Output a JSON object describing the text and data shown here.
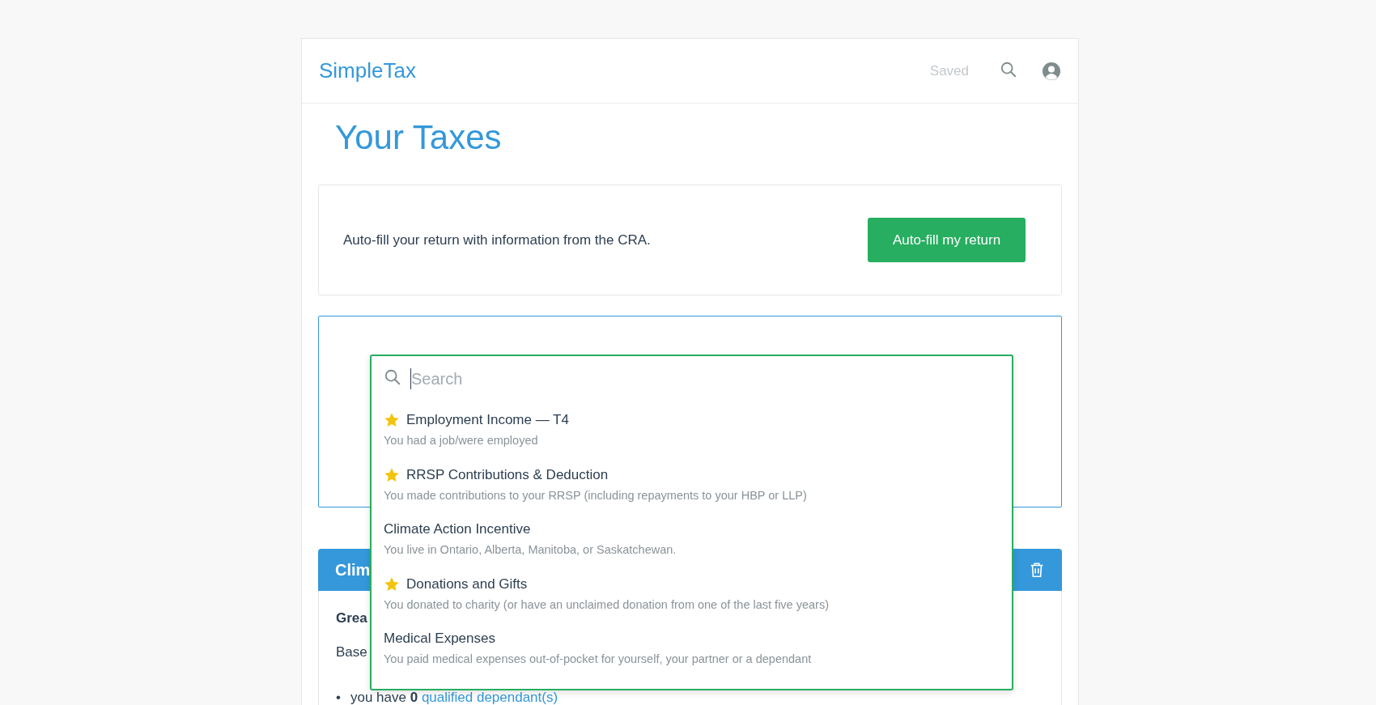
{
  "header": {
    "logo": "SimpleTax",
    "status": "Saved"
  },
  "page_title": "Your Taxes",
  "autofill": {
    "text": "Auto-fill your return with information from the CRA.",
    "button": "Auto-fill my return"
  },
  "search": {
    "placeholder": "Search"
  },
  "suggestions": [
    {
      "title": "Employment Income — T4",
      "subtitle": "You had a job/were employed",
      "starred": true
    },
    {
      "title": "RRSP Contributions & Deduction",
      "subtitle": "You made contributions to your RRSP (including repayments to your HBP or LLP)",
      "starred": true
    },
    {
      "title": "Climate Action Incentive",
      "subtitle": "You live in Ontario, Alberta, Manitoba, or Saskatchewan.",
      "starred": false
    },
    {
      "title": "Donations and Gifts",
      "subtitle": "You donated to charity (or have an unclaimed donation from one of the last five years)",
      "starred": true
    },
    {
      "title": "Medical Expenses",
      "subtitle": "You paid medical expenses out-of-pocket for yourself, your partner or a dependant",
      "starred": false
    }
  ],
  "section": {
    "title": "Clim",
    "heading": "Grea",
    "text": "Base",
    "bullets": [
      {
        "marker": "•",
        "text": "you have **0**",
        "link": "qualified dependant(s)"
      }
    ]
  }
}
